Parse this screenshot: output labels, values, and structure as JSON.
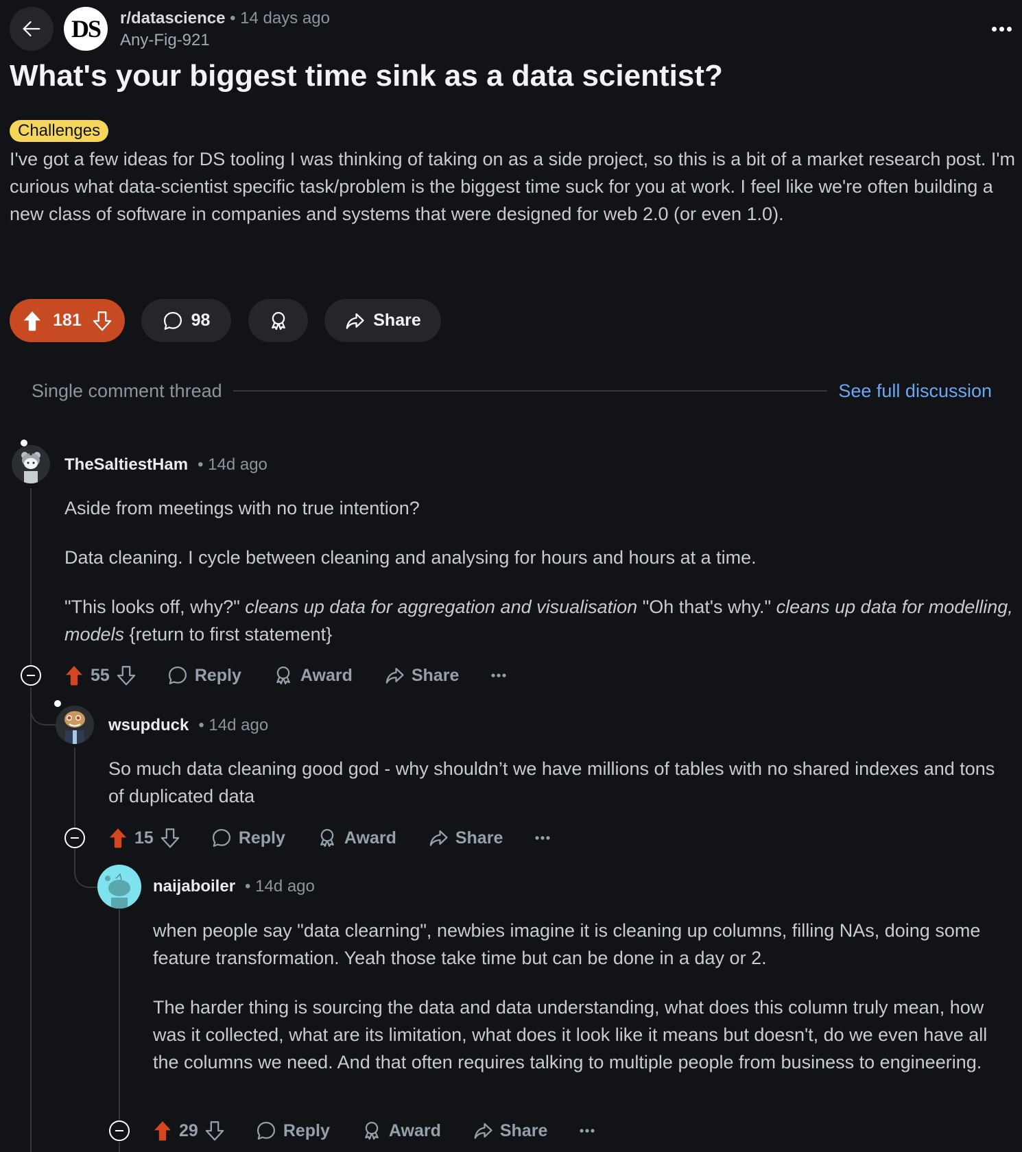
{
  "header": {
    "back_label": "Back",
    "subreddit_avatar_text": "DS",
    "subreddit": "r/datascience",
    "separator": "•",
    "post_age": "14 days ago",
    "author": "Any-Fig-921"
  },
  "post": {
    "title": "What's your biggest time sink as a data scientist?",
    "flair": "Challenges",
    "flair_color": "#f5d55a",
    "body": "I've got a few ideas for DS tooling I was thinking of taking on as a side project, so this is a bit of a market research post. I'm curious what data-scientist specific task/problem is the biggest time suck for you at work. I feel like we're often building a new class of software in companies and systems that were designed for web 2.0 (or even 1.0).",
    "votes": "181",
    "comments": "98",
    "share_label": "Share",
    "vote_color": "#c84a23"
  },
  "thread": {
    "label": "Single comment thread",
    "link": "See full discussion",
    "link_color": "#6ea6f5"
  },
  "comments": [
    {
      "user": "TheSaltiestHam",
      "time": "• 14d ago",
      "paragraphs": [
        [
          {
            "t": "Aside from meetings with no true intention?",
            "i": false
          }
        ],
        [
          {
            "t": "Data cleaning. I cycle between cleaning and analysing for hours and hours at a time.",
            "i": false
          }
        ],
        [
          {
            "t": "\"This looks off, why?\" ",
            "i": false
          },
          {
            "t": "cleans up data for aggregation and visualisation",
            "i": true
          },
          {
            "t": " \"Oh that's why.\" ",
            "i": false
          },
          {
            "t": "cleans up data for modelling, models",
            "i": true
          },
          {
            "t": " {return to first statement}",
            "i": false
          }
        ]
      ],
      "votes": "55",
      "reply": "Reply",
      "award": "Award",
      "share": "Share"
    },
    {
      "user": "wsupduck",
      "time": "• 14d ago",
      "paragraphs": [
        [
          {
            "t": "So much data cleaning good god - why shouldn’t we have millions of tables with no shared indexes and tons of duplicated data",
            "i": false
          }
        ]
      ],
      "votes": "15",
      "reply": "Reply",
      "award": "Award",
      "share": "Share"
    },
    {
      "user": "naijaboiler",
      "time": "• 14d ago",
      "paragraphs": [
        [
          {
            "t": "when people say \"data clearning\", newbies imagine it is cleaning up columns, filling NAs, doing some feature transformation. Yeah those take time but can be done in a day or 2.",
            "i": false
          }
        ],
        [
          {
            "t": "The harder thing is sourcing the data and data understanding, what does this column truly mean, how was it collected, what are its limitation, what does it look like it means but doesn't, do we even have all the columns we need. And that often requires talking to multiple people from business to engineering.",
            "i": false
          }
        ]
      ],
      "votes": "29",
      "reply": "Reply",
      "award": "Award",
      "share": "Share"
    }
  ]
}
